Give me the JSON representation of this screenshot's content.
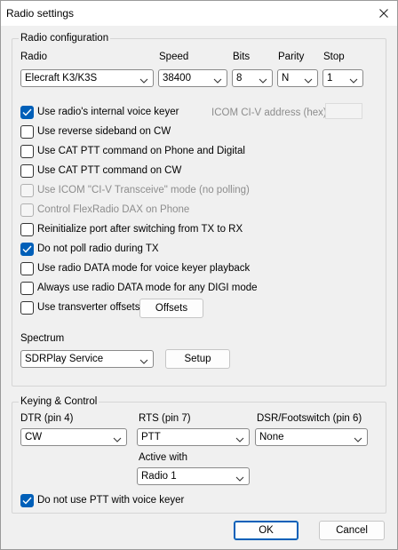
{
  "window": {
    "title": "Radio settings"
  },
  "radio_config": {
    "group_label": "Radio configuration",
    "radio": {
      "label": "Radio",
      "value": "Elecraft K3/K3S"
    },
    "speed": {
      "label": "Speed",
      "value": "38400"
    },
    "bits": {
      "label": "Bits",
      "value": "8"
    },
    "parity": {
      "label": "Parity",
      "value": "N"
    },
    "stop": {
      "label": "Stop",
      "value": "1"
    },
    "icom_address_label": "ICOM CI-V address (hex)",
    "icom_address_value": "",
    "options": [
      {
        "label": "Use radio's internal voice keyer",
        "checked": true,
        "disabled": false
      },
      {
        "label": "Use reverse sideband on CW",
        "checked": false,
        "disabled": false
      },
      {
        "label": "Use CAT PTT command on Phone and Digital",
        "checked": false,
        "disabled": false
      },
      {
        "label": "Use CAT PTT command on CW",
        "checked": false,
        "disabled": false
      },
      {
        "label": "Use ICOM \"CI-V Transceive\" mode (no polling)",
        "checked": false,
        "disabled": true
      },
      {
        "label": "Control FlexRadio DAX on Phone",
        "checked": false,
        "disabled": true
      },
      {
        "label": "Reinitialize port after switching from TX to RX",
        "checked": false,
        "disabled": false
      },
      {
        "label": "Do not poll radio during TX",
        "checked": true,
        "disabled": false
      },
      {
        "label": "Use radio DATA mode for voice keyer playback",
        "checked": false,
        "disabled": false
      },
      {
        "label": "Always use radio DATA mode for any DIGI mode",
        "checked": false,
        "disabled": false
      },
      {
        "label": "Use transverter offsets",
        "checked": false,
        "disabled": false
      }
    ],
    "offsets_button": "Offsets",
    "spectrum": {
      "label": "Spectrum",
      "value": "SDRPlay Service",
      "setup_button": "Setup"
    }
  },
  "keying": {
    "group_label": "Keying & Control",
    "dtr": {
      "label": "DTR (pin 4)",
      "value": "CW"
    },
    "rts": {
      "label": "RTS (pin 7)",
      "value": "PTT"
    },
    "dsr": {
      "label": "DSR/Footswitch (pin 6)",
      "value": "None"
    },
    "active_with": {
      "label": "Active with",
      "value": "Radio 1"
    },
    "no_ptt_voice": {
      "label": "Do not use PTT with voice keyer",
      "checked": true
    }
  },
  "buttons": {
    "ok": "OK",
    "cancel": "Cancel"
  },
  "colors": {
    "accent": "#005fb8",
    "background": "#f0f0f0"
  }
}
